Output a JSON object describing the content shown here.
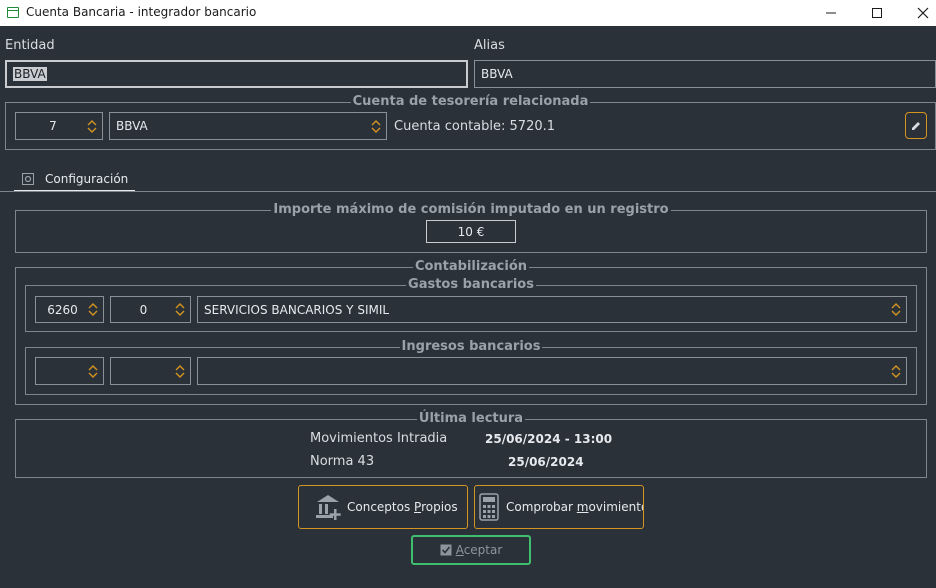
{
  "window": {
    "title": "Cuenta Bancaria - integrador bancario",
    "minimize_icon": "minimize-icon",
    "maximize_icon": "maximize-icon",
    "close_icon": "close-icon"
  },
  "entidad": {
    "label": "Entidad",
    "value": "BBVA"
  },
  "alias": {
    "label": "Alias",
    "value": "BBVA"
  },
  "tesoreria": {
    "title": "Cuenta de tesorería relacionada",
    "number": "7",
    "name": "BBVA",
    "cuenta_contable": "Cuenta contable: 5720.1",
    "edit_icon": "pencil-icon"
  },
  "tab": {
    "label": "Configuración",
    "icon": "gear-icon"
  },
  "comision": {
    "title": "Importe máximo de comisión imputado en un registro",
    "value": "10 €"
  },
  "contabilizacion": {
    "title": "Contabilización",
    "gastos": {
      "title": "Gastos bancarios",
      "account": "6260",
      "sub": "0",
      "description": "SERVICIOS BANCARIOS Y SIMIL"
    },
    "ingresos": {
      "title": "Ingresos bancarios",
      "account": "",
      "sub": "",
      "description": ""
    }
  },
  "ultima_lectura": {
    "title": "Última lectura",
    "rows": [
      {
        "label": "Movimientos Intradia",
        "value": "25/06/2024 - 13:00"
      },
      {
        "label": "Norma 43",
        "value": "25/06/2024"
      }
    ]
  },
  "buttons": {
    "conceptos_pre": "Conceptos ",
    "conceptos_mn": "P",
    "conceptos_post": "ropios",
    "comprobar_pre": "Comprobar ",
    "comprobar_mn": "m",
    "comprobar_post": "ovimientos",
    "aceptar_mn": "A",
    "aceptar_post": "ceptar"
  },
  "colors": {
    "background": "#2b3139",
    "accent": "#d39420",
    "ok": "#3fbf6d"
  }
}
